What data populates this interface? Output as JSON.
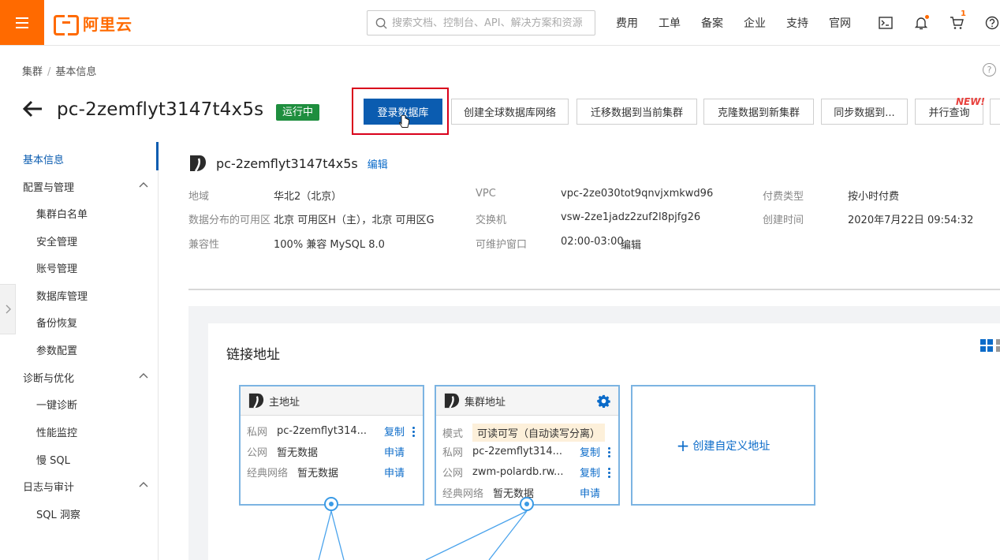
{
  "topbar": {
    "brand": "阿里云",
    "search_placeholder": "搜索文档、控制台、API、解决方案和资源",
    "links": [
      "费用",
      "工单",
      "备案",
      "企业",
      "支持",
      "官网"
    ],
    "cart_count": "1",
    "colors": {
      "brand": "#ff6a00",
      "primary": "#0b5cb0"
    }
  },
  "breadcrumb": [
    "集群",
    "基本信息"
  ],
  "header": {
    "cluster_id": "pc-2zemflyt3147t4x5s",
    "status": "运行中",
    "actions": [
      "登录数据库",
      "创建全球数据库网络",
      "迁移数据到当前集群",
      "克隆数据到新集群",
      "同步数据到...",
      "并行查询"
    ],
    "new_tag": "NEW!"
  },
  "sidebar": {
    "active": "基本信息",
    "groups": [
      {
        "title": "配置与管理",
        "items": [
          "集群白名单",
          "安全管理",
          "账号管理",
          "数据库管理",
          "备份恢复",
          "参数配置"
        ]
      },
      {
        "title": "诊断与优化",
        "items": [
          "一键诊断",
          "性能监控",
          "慢 SQL"
        ]
      },
      {
        "title": "日志与审计",
        "items": [
          "SQL 洞察"
        ]
      }
    ]
  },
  "instance": {
    "name": "pc-2zemflyt3147t4x5s",
    "edit": "编辑",
    "fields": {
      "region_label": "地域",
      "region": "华北2（北京）",
      "zone_label": "数据分布的可用区",
      "zone": "北京 可用区H（主），北京 可用区G",
      "compat_label": "兼容性",
      "compat": "100% 兼容 MySQL 8.0",
      "vpc_label": "VPC",
      "vpc": "vpc-2ze030tot9qnvjxmkwd96",
      "switch_label": "交换机",
      "switch": "vsw-2ze1jadz2zuf2l8pjfg26",
      "window_label": "可维护窗口",
      "window": "02:00-03:00",
      "window_edit": "编辑",
      "billing_label": "付费类型",
      "billing": "按小时付费",
      "created_label": "创建时间",
      "created": "2020年7月22日 09:54:32"
    }
  },
  "connection": {
    "title": "链接地址",
    "primary": {
      "title": "主地址",
      "private_label": "私网",
      "private": "pc-2zemflyt314...",
      "copy": "复制",
      "public_label": "公网",
      "public": "暂无数据",
      "apply": "申请",
      "classic_label": "经典网络",
      "classic": "暂无数据",
      "classic_apply": "申请"
    },
    "cluster": {
      "title": "集群地址",
      "mode_label": "模式",
      "mode": "可读可写（自动读写分离）",
      "private_label": "私网",
      "private": "pc-2zemflyt314...",
      "copy": "复制",
      "public_label": "公网",
      "public": "zwm-polardb.rw...",
      "public_copy": "复制",
      "classic_label": "经典网络",
      "classic": "暂无数据",
      "apply": "申请"
    },
    "add_custom": "创建自定义地址"
  }
}
